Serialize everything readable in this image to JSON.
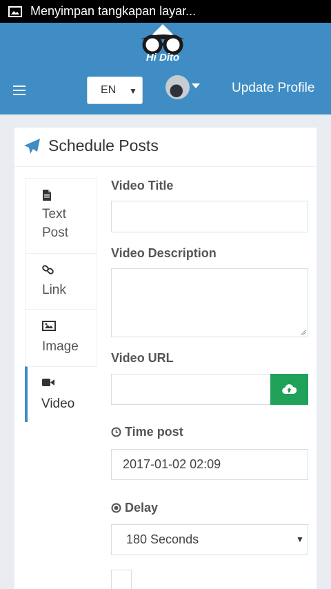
{
  "status_bar": {
    "notification_text": "Menyimpan tangkapan layar...",
    "icon": "image-icon"
  },
  "header": {
    "logo_text": "Hi Dito",
    "language": {
      "value": "EN"
    },
    "update_profile_label": "Update Profile",
    "bg_color": "#3f8dc4"
  },
  "card": {
    "title": "Schedule Posts",
    "tabs": [
      {
        "label": "Text Post",
        "icon": "document-icon"
      },
      {
        "label": "Link",
        "icon": "link-icon"
      },
      {
        "label": "Image",
        "icon": "image-icon"
      },
      {
        "label": "Video",
        "icon": "video-icon",
        "active": true
      }
    ],
    "fields": {
      "video_title_label": "Video Title",
      "video_title_value": "",
      "video_description_label": "Video Description",
      "video_description_value": "",
      "video_url_label": "Video URL",
      "video_url_value": "",
      "time_post_label": "Time post",
      "time_post_value": "2017-01-02 02:09",
      "delay_label": "Delay",
      "delay_value": "180 Seconds"
    },
    "accent_color": "#3f8dc4",
    "upload_color": "#1fa15a"
  }
}
